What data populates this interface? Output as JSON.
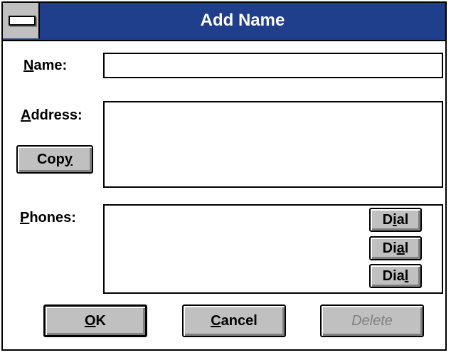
{
  "window": {
    "title": "Add Name",
    "colors": {
      "titlebar": "#1f3e8c",
      "face": "#c0c0c0",
      "disabled_text": "#808080"
    }
  },
  "form": {
    "name_label": {
      "mnemonic": "N",
      "rest": "ame:"
    },
    "name_value": "",
    "address_label": {
      "mnemonic": "A",
      "rest": "ddress:"
    },
    "address_value": "",
    "copy_button": {
      "before": "Cop",
      "mnemonic": "y",
      "after": ""
    },
    "phones_label": {
      "mnemonic": "P",
      "rest": "hones:"
    },
    "phones_value": "",
    "dial_buttons": [
      {
        "before": "D",
        "mnemonic": "i",
        "after": "al"
      },
      {
        "before": "Di",
        "mnemonic": "a",
        "after": "l"
      },
      {
        "before": "Dia",
        "mnemonic": "l",
        "after": ""
      }
    ]
  },
  "buttons": {
    "ok": {
      "mnemonic": "O",
      "rest": "K"
    },
    "cancel": {
      "mnemonic": "C",
      "rest": "ancel"
    },
    "delete": {
      "label": "Delete",
      "enabled": false
    }
  }
}
